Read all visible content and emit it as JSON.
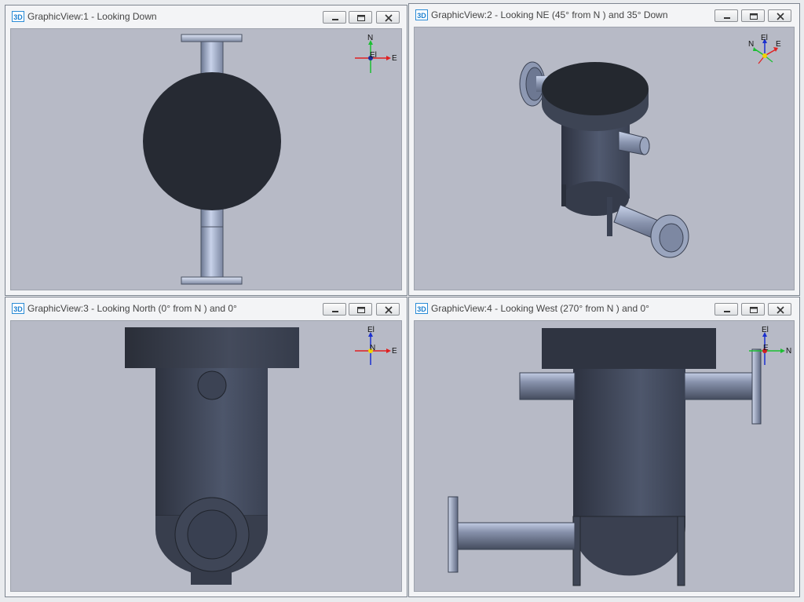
{
  "windows": [
    {
      "badge": "3D",
      "title": "GraphicView:1 - Looking Down",
      "triad": {
        "up": "N",
        "right": "E",
        "center": "El"
      }
    },
    {
      "badge": "3D",
      "title": "GraphicView:2 - Looking NE (45° from N ) and 35° Down",
      "triad": {
        "up": "El",
        "right": "E",
        "left": "N"
      }
    },
    {
      "badge": "3D",
      "title": "GraphicView:3 - Looking North (0° from N ) and 0°",
      "triad": {
        "up": "El",
        "right": "E",
        "center": "N"
      }
    },
    {
      "badge": "3D",
      "title": "GraphicView:4 - Looking West (270° from N ) and 0°",
      "triad": {
        "up": "El",
        "right": "N",
        "center": "E"
      }
    }
  ],
  "icons": {
    "minimize": "minimize-icon",
    "restore": "restore-icon",
    "close": "close-icon"
  }
}
